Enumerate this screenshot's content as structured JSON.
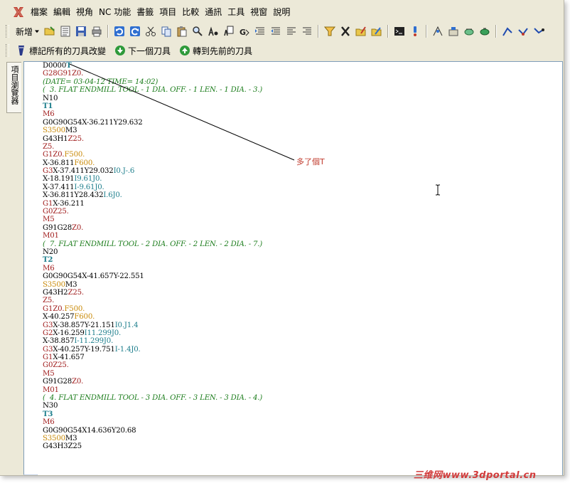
{
  "menubar": {
    "items": [
      "檔案",
      "編輯",
      "視角",
      "NC 功能",
      "書籤",
      "項目",
      "比較",
      "通訊",
      "工具",
      "視窗",
      "說明"
    ]
  },
  "toolbar1": {
    "new_label": "新增"
  },
  "toolbar2": {
    "mark_changes_label": "標記所有的刀具改變",
    "next_tool_label": "下一個刀具",
    "prev_tool_label": "轉到先前的刀具"
  },
  "side_tab": {
    "label": "項目瀏覽器"
  },
  "annotation": {
    "text": "多了個T"
  },
  "watermark": {
    "text": "三维网www.3dportal.cn"
  },
  "colors": {
    "red": "#a01d1d",
    "green": "#1c7d1c",
    "teal": "#1d7e8c",
    "orange": "#c98a08",
    "blue": "#1f4bb0"
  },
  "code_lines": [
    [
      [
        "D0000",
        "black"
      ],
      [
        "T",
        "teal-b"
      ]
    ],
    [
      [
        "G28G91",
        "red"
      ],
      [
        "Z0.",
        "red"
      ]
    ],
    [
      [
        "(DATE= 03-04-12 TIME= 14:02)",
        "green"
      ]
    ],
    [
      [
        "(  3. FLAT ENDMILL TOOL - 1 DIA. OFF. - 1 LEN. - 1 DIA. - 3.)",
        "green"
      ]
    ],
    [
      [
        "N10",
        "black"
      ]
    ],
    [
      [
        "T1",
        "teal-b"
      ]
    ],
    [
      [
        "M6",
        "red"
      ]
    ],
    [
      [
        "G0G90G54X-36.211Y29.632",
        "black"
      ]
    ],
    [
      [
        "S3500",
        "orange"
      ],
      [
        "M3",
        "black"
      ]
    ],
    [
      [
        "G43H1",
        "black"
      ],
      [
        "Z25.",
        "red"
      ]
    ],
    [
      [
        "Z5.",
        "red"
      ]
    ],
    [
      [
        "G1",
        "red"
      ],
      [
        "Z0.",
        "red"
      ],
      [
        "F500.",
        "orange"
      ]
    ],
    [
      [
        "X-36.811",
        "black"
      ],
      [
        "F600.",
        "orange"
      ]
    ],
    [
      [
        "G3",
        "red"
      ],
      [
        "X-37.411Y29.032",
        "black"
      ],
      [
        "I0.J-.6",
        "teal"
      ]
    ],
    [
      [
        "X-18.191",
        "black"
      ],
      [
        "I9.61J0.",
        "teal"
      ]
    ],
    [
      [
        "X-37.411",
        "black"
      ],
      [
        "I-9.61J0.",
        "teal"
      ]
    ],
    [
      [
        "X-36.811Y28.432",
        "black"
      ],
      [
        "I.6J0.",
        "teal"
      ]
    ],
    [
      [
        "G1",
        "red"
      ],
      [
        "X-36.211",
        "black"
      ]
    ],
    [
      [
        "G0",
        "red"
      ],
      [
        "Z25.",
        "red"
      ]
    ],
    [
      [
        "M5",
        "red"
      ]
    ],
    [
      [
        "G91G28",
        "black"
      ],
      [
        "Z0.",
        "red"
      ]
    ],
    [
      [
        "M01",
        "red"
      ]
    ],
    [
      [
        "(  7. FLAT ENDMILL TOOL - 2 DIA. OFF. - 2 LEN. - 2 DIA. - 7.)",
        "green"
      ]
    ],
    [
      [
        "N20",
        "black"
      ]
    ],
    [
      [
        "T2",
        "teal-b"
      ]
    ],
    [
      [
        "M6",
        "red"
      ]
    ],
    [
      [
        "G0G90G54X-41.657Y-22.551",
        "black"
      ]
    ],
    [
      [
        "S3500",
        "orange"
      ],
      [
        "M3",
        "black"
      ]
    ],
    [
      [
        "G43H2",
        "black"
      ],
      [
        "Z25.",
        "red"
      ]
    ],
    [
      [
        "Z5.",
        "red"
      ]
    ],
    [
      [
        "G1",
        "red"
      ],
      [
        "Z0.",
        "red"
      ],
      [
        "F500.",
        "orange"
      ]
    ],
    [
      [
        "X-40.257",
        "black"
      ],
      [
        "F600.",
        "orange"
      ]
    ],
    [
      [
        "G3",
        "red"
      ],
      [
        "X-38.857Y-21.151",
        "black"
      ],
      [
        "I0.J1.4",
        "teal"
      ]
    ],
    [
      [
        "G2",
        "red"
      ],
      [
        "X-16.259",
        "black"
      ],
      [
        "I11.299J0.",
        "teal"
      ]
    ],
    [
      [
        "X-38.857",
        "black"
      ],
      [
        "I-11.299J0.",
        "teal"
      ]
    ],
    [
      [
        "G3",
        "red"
      ],
      [
        "X-40.257Y-19.751",
        "black"
      ],
      [
        "I-1.4J0.",
        "teal"
      ]
    ],
    [
      [
        "G1",
        "red"
      ],
      [
        "X-41.657",
        "black"
      ]
    ],
    [
      [
        "G0",
        "red"
      ],
      [
        "Z25.",
        "red"
      ]
    ],
    [
      [
        "M5",
        "red"
      ]
    ],
    [
      [
        "G91G28",
        "black"
      ],
      [
        "Z0.",
        "red"
      ]
    ],
    [
      [
        "M01",
        "red"
      ]
    ],
    [
      [
        "(  4. FLAT ENDMILL TOOL - 3 DIA. OFF. - 3 LEN. - 3 DIA. - 4.)",
        "green"
      ]
    ],
    [
      [
        "N30",
        "black"
      ]
    ],
    [
      [
        "T3",
        "teal-b"
      ]
    ],
    [
      [
        "M6",
        "red"
      ]
    ],
    [
      [
        "G0G90G54X14.636Y20.68",
        "black"
      ]
    ],
    [
      [
        "S3500",
        "orange"
      ],
      [
        "M3",
        "black"
      ]
    ],
    [
      [
        "G43H3Z25",
        "black"
      ]
    ]
  ]
}
